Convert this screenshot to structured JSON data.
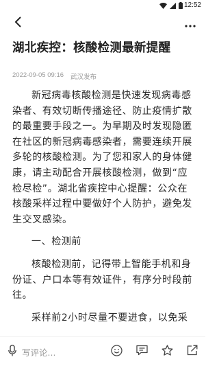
{
  "status_bar": {
    "time": "12:52",
    "icons": [
      "wifi-icon",
      "signal-icon",
      "battery-icon"
    ]
  },
  "top_bar": {
    "back_icon": "chevron-left-icon",
    "more_icon": "more-dots-icon"
  },
  "article": {
    "title": "湖北疾控：核酸检测最新提醒",
    "date": "2022-09-05 09:16",
    "source": "武汉发布",
    "paragraphs": [
      "新冠病毒核酸检测是快速发现病毒感染者、有效切断传播途径、防止疫情扩散的最重要手段之一。为早期及时发现隐匿在社区的新冠病毒感染者，需要连续开展多轮的核酸检测。为了您和家人的身体健康，请主动配合开展核酸检测，做到“应检尽检”。湖北省疾控中心提醒：公众在核酸采样过程中要做好个人防护，避免发生交叉感染。",
      "一、检测前",
      "核酸检测前，记得带上智能手机和身份证、户口本等有效证件，有序分时段前往。",
      "采样前2小时尽量不要进食，以免采"
    ]
  },
  "bottom_bar": {
    "comment_placeholder": "写评论...",
    "icons": [
      "microphone-icon",
      "emoji-icon",
      "comment-icon",
      "favorite-star-icon",
      "share-icon"
    ]
  }
}
